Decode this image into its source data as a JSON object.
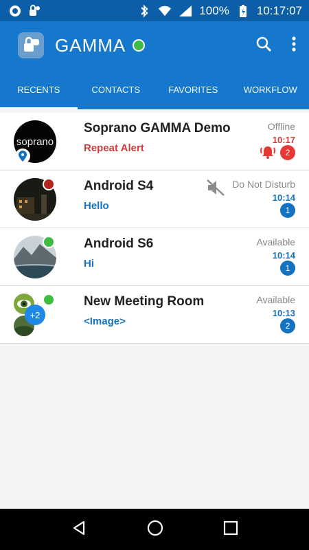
{
  "status_bar": {
    "battery": "100%",
    "time": "10:17:07"
  },
  "app": {
    "title": "GAMMA",
    "status_color": "#3fbd43"
  },
  "tabs": [
    {
      "label": "RECENTS",
      "active": true
    },
    {
      "label": "CONTACTS",
      "active": false
    },
    {
      "label": "FAVORITES",
      "active": false
    },
    {
      "label": "WORKFLOW",
      "active": false
    }
  ],
  "conversations": [
    {
      "name": "Soprano GAMMA Demo",
      "message": "Repeat Alert",
      "presence": "Offline",
      "time": "10:17",
      "unread": "2",
      "avatar_text": "soprano",
      "accent": "#e53935"
    },
    {
      "name": "Android S4",
      "message": "Hello",
      "presence": "Do Not Disturb",
      "time": "10:14",
      "unread": "1",
      "accent": "#1572c0",
      "presence_color": "#b3261e"
    },
    {
      "name": "Android S6",
      "message": "Hi",
      "presence": "Available",
      "time": "10:14",
      "unread": "1",
      "accent": "#1572c0",
      "presence_color": "#3fbd43"
    },
    {
      "name": "New Meeting Room",
      "message": "<Image>",
      "presence": "Available",
      "time": "10:13",
      "unread": "2",
      "avatar_text": "+2",
      "accent": "#1572c0",
      "presence_color": "#3fbd43"
    }
  ]
}
